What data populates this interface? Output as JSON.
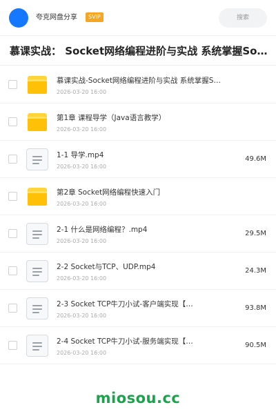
{
  "header": {
    "app_name": "夸克网盘分享",
    "badge": "SVIP",
    "search_label": "搜索",
    "avatar_color": "#1677ff"
  },
  "title": "慕课实战： Socket网络编程进阶与实战 系统掌握Socket核心技术",
  "files": [
    {
      "type": "folder",
      "name": "慕课实战-Socket网络编程进阶与实战 系统掌握Socket核心技术",
      "date": "2026-03-20 16:00",
      "size": ""
    },
    {
      "type": "folder",
      "name": "第1章 课程导学（Java语言教学）",
      "date": "2026-03-20 16:00",
      "size": ""
    },
    {
      "type": "file",
      "name": "1-1  导学.mp4",
      "date": "2026-03-20 16:00",
      "size": "49.6M"
    },
    {
      "type": "folder",
      "name": "第2章 Socket网络编程快速入门",
      "date": "2026-03-20 16:00",
      "size": ""
    },
    {
      "type": "file",
      "name": "2-1 什么是网络编程？.mp4",
      "date": "2026-03-20 16:00",
      "size": "29.5M"
    },
    {
      "type": "file",
      "name": "2-2 Socket与TCP、UDP.mp4",
      "date": "2026-03-20 16:00",
      "size": "24.3M"
    },
    {
      "type": "file",
      "name": "2-3 Socket TCP牛刀小试-客户端实现【…",
      "date": "2026-03-20 16:00",
      "size": "93.8M"
    },
    {
      "type": "file",
      "name": "2-4 Socket TCP牛刀小试-服务端实现【…",
      "date": "2026-03-20 16:00",
      "size": "90.5M"
    }
  ],
  "watermark": "miosou.cc",
  "colors": {
    "folder": "#ffc107",
    "badge": "#f5a623",
    "watermark": "#1aa34a"
  }
}
